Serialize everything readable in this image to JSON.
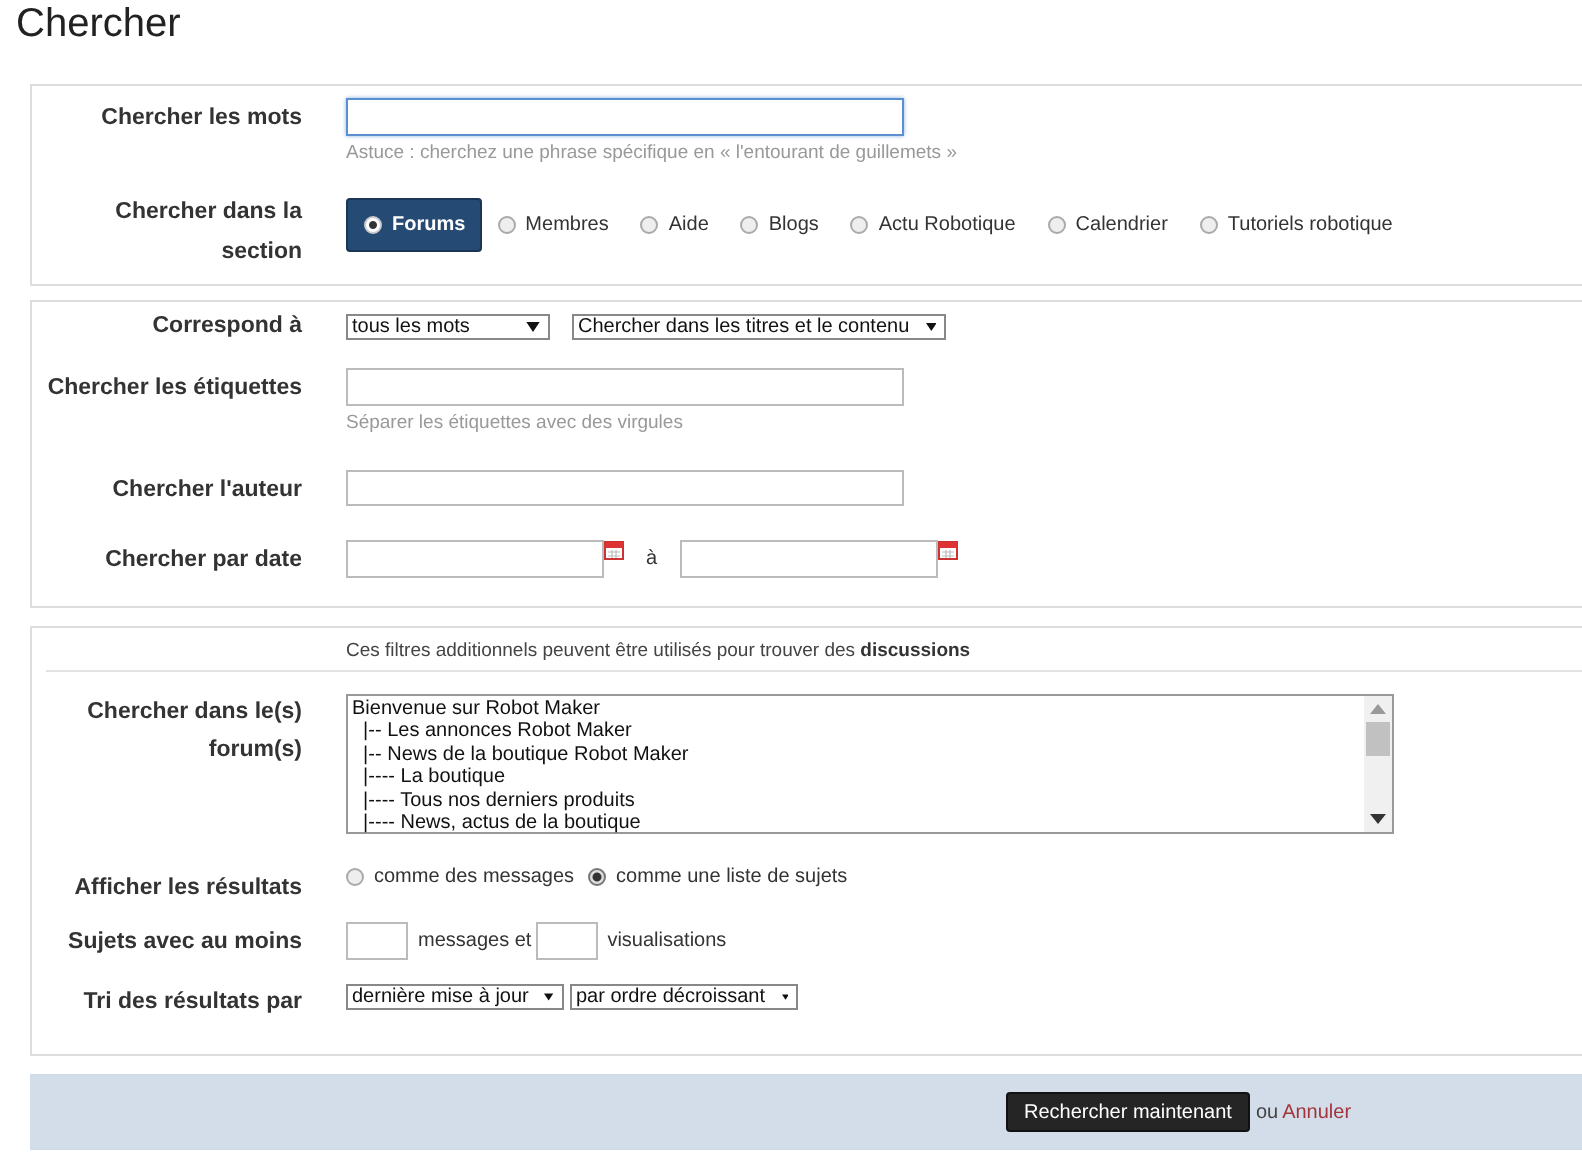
{
  "title": "Chercher",
  "keywords": {
    "label": "Chercher les mots",
    "hint": "Astuce : cherchez une phrase spécifique en « l'entourant de guillemets »"
  },
  "section": {
    "label": "Chercher dans la section",
    "options": [
      {
        "label": "Forums",
        "selected": true
      },
      {
        "label": "Membres",
        "selected": false
      },
      {
        "label": "Aide",
        "selected": false
      },
      {
        "label": "Blogs",
        "selected": false
      },
      {
        "label": "Actu Robotique",
        "selected": false
      },
      {
        "label": "Calendrier",
        "selected": false
      },
      {
        "label": "Tutoriels robotique",
        "selected": false
      }
    ]
  },
  "match": {
    "label": "Correspond à",
    "selects": [
      "tous les mots",
      "Chercher dans les titres et le contenu"
    ]
  },
  "tags": {
    "label": "Chercher les étiquettes",
    "hint": "Séparer les étiquettes avec des virgules"
  },
  "author": {
    "label": "Chercher l'auteur"
  },
  "date": {
    "label": "Chercher par date",
    "separator": "à"
  },
  "filters": {
    "note": "Ces filtres additionnels peuvent être utilisés pour trouver des **discussions**",
    "forums": {
      "label": "Chercher dans le(s) forum(s)",
      "items": [
        "Bienvenue sur Robot Maker",
        "  |-- Les annonces Robot Maker",
        "  |-- News de la boutique Robot Maker",
        "  |---- La boutique",
        "  |---- Tous nos derniers produits",
        "  |---- News, actus de la boutique"
      ]
    },
    "display": {
      "label": "Afficher les résultats",
      "options": [
        {
          "label": "comme des messages",
          "selected": false
        },
        {
          "label": "comme une liste de sujets",
          "selected": true
        }
      ]
    },
    "minimum": {
      "label": "Sujets avec au moins",
      "parts": [
        "messages et",
        "visualisations"
      ]
    },
    "sort": {
      "label": "Tri des résultats par",
      "selects": [
        "dernière mise à jour",
        "par ordre décroissant"
      ]
    }
  },
  "actions": {
    "submit": "Rechercher maintenant",
    "or": "ou",
    "cancel": "Annuler"
  }
}
